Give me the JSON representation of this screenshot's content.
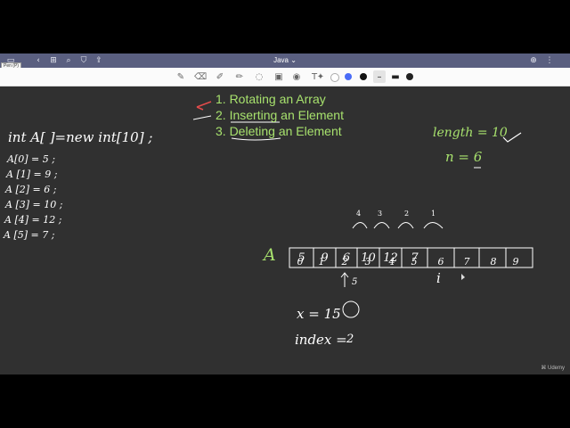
{
  "window": {
    "title": "Java ⌄",
    "pen_tooltip": "Pen (P)"
  },
  "toolbar": {
    "tools": [
      "pen-icon",
      "eraser-icon",
      "highlighter-icon",
      "pencil-icon",
      "lasso-icon",
      "image-icon",
      "text-icon",
      "star-icon"
    ],
    "colors": {
      "white": "#ffffff",
      "blue": "#4a6cf7",
      "black": "#111111"
    }
  },
  "notes": {
    "topics": [
      "1. Rotating an Array",
      "2. Inserting an Element",
      "3. Deleting an Element"
    ],
    "declaration": "int A[ ]=new int[10] ;",
    "assignments": [
      "A[0] = 5 ;",
      "A [1] = 9 ;",
      "A [2] = 6 ;",
      "A [3] = 10 ;",
      "A [4] = 12 ;",
      "A [5] = 7 ;"
    ],
    "length_label": "length = 10",
    "n_label": "n = 6",
    "array_name": "A",
    "indices": [
      "0",
      "1",
      "2",
      "3",
      "4",
      "5",
      "6",
      "7",
      "8",
      "9"
    ],
    "cells": [
      "5",
      "9",
      "6",
      "10",
      "12",
      "7",
      "",
      "",
      "",
      ""
    ],
    "shift_steps": [
      "4",
      "3",
      "2",
      "1"
    ],
    "pointer_label": "5",
    "i_label": "i",
    "x_label": "x = 15",
    "index_label": "index =",
    "index_value": "2"
  },
  "watermark": "Udemy"
}
